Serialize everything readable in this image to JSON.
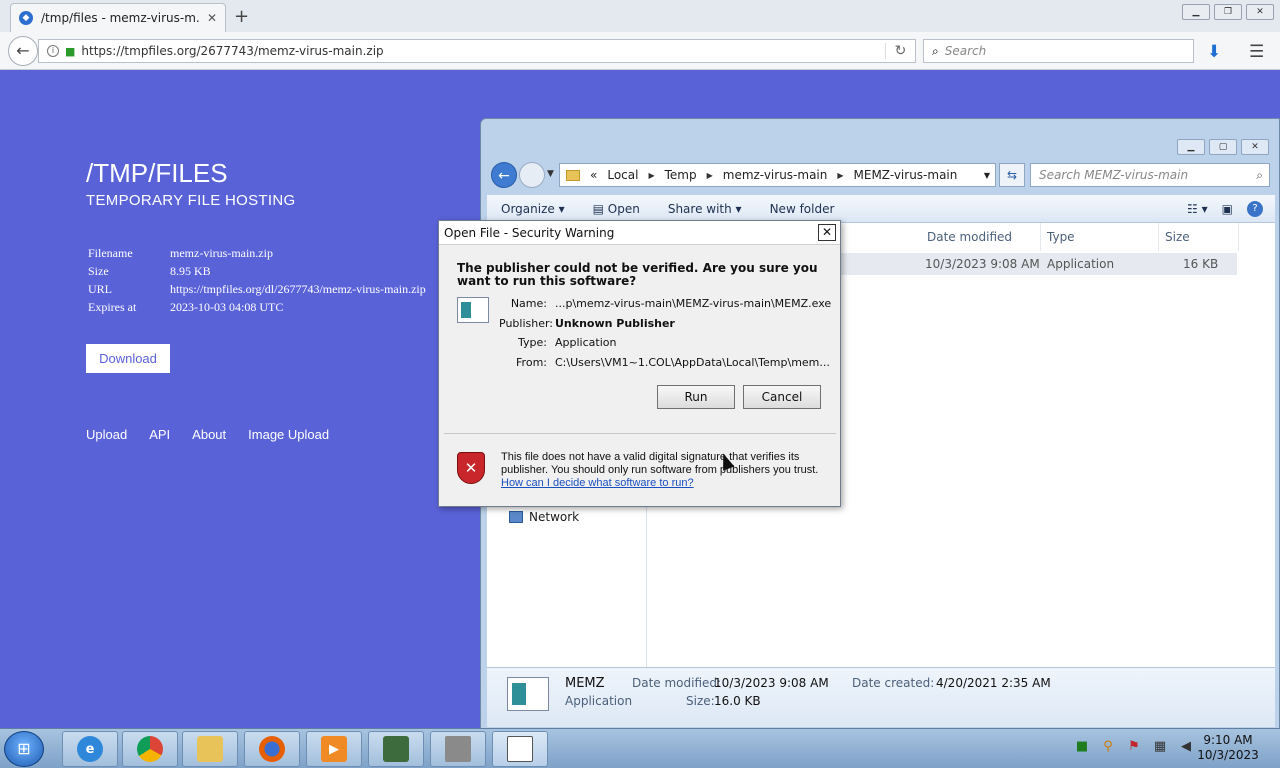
{
  "browser": {
    "tab_title": "/tmp/files - memz-virus-m...",
    "tab_close": "✕",
    "new_tab": "+",
    "url": "https://tmpfiles.org/2677743/memz-virus-main.zip",
    "search_placeholder": "Search"
  },
  "page": {
    "title": "/TMP/FILES",
    "subtitle": "TEMPORARY FILE HOSTING",
    "meta": [
      {
        "key": "Filename",
        "value": "memz-virus-main.zip"
      },
      {
        "key": "Size",
        "value": "8.95 KB"
      },
      {
        "key": "URL",
        "value": "https://tmpfiles.org/dl/2677743/memz-virus-main.zip"
      },
      {
        "key": "Expires at",
        "value": "2023-10-03 04:08 UTC"
      }
    ],
    "download_label": "Download",
    "nav": [
      "Upload",
      "API",
      "About",
      "Image Upload"
    ]
  },
  "explorer": {
    "breadcrumb": [
      "«",
      "Local",
      "Temp",
      "memz-virus-main",
      "MEMZ-virus-main"
    ],
    "search_placeholder": "Search MEMZ-virus-main",
    "toolbar": {
      "organize": "Organize ▾",
      "open": "Open",
      "share": "Share with ▾",
      "new_folder": "New folder"
    },
    "columns": {
      "date": "Date modified",
      "type": "Type",
      "size": "Size"
    },
    "file": {
      "date": "10/3/2023 9:08 AM",
      "type": "Application",
      "size": "16 KB"
    },
    "nav_network": "Network",
    "details": {
      "name": "MEMZ",
      "kind": "Application",
      "modified_label": "Date modified:",
      "modified": "10/3/2023 9:08 AM",
      "created_label": "Date created:",
      "created": "4/20/2021 2:35 AM",
      "size_label": "Size:",
      "size": "16.0 KB"
    }
  },
  "dialog": {
    "title": "Open File - Security Warning",
    "close": "✕",
    "question": "The publisher could not be verified.  Are you sure you want to run this software?",
    "fields": [
      {
        "key": "Name:",
        "value": "...p\\memz-virus-main\\MEMZ-virus-main\\MEMZ.exe",
        "bold": false
      },
      {
        "key": "Publisher:",
        "value": "Unknown Publisher",
        "bold": true
      },
      {
        "key": "Type:",
        "value": "Application",
        "bold": false
      },
      {
        "key": "From:",
        "value": "C:\\Users\\VM1~1.COL\\AppData\\Local\\Temp\\mem...",
        "bold": false
      }
    ],
    "run": "Run",
    "cancel": "Cancel",
    "warning": "This file does not have a valid digital signature that verifies its publisher.  You should only run software from publishers you trust.",
    "link": "How can I decide what software to run?"
  },
  "taskbar": {
    "time": "9:10 AM",
    "date": "10/3/2023"
  },
  "colors": {
    "page_bg": "#5a62d8",
    "link": "#1a4fbf",
    "shield": "#c9262b"
  }
}
